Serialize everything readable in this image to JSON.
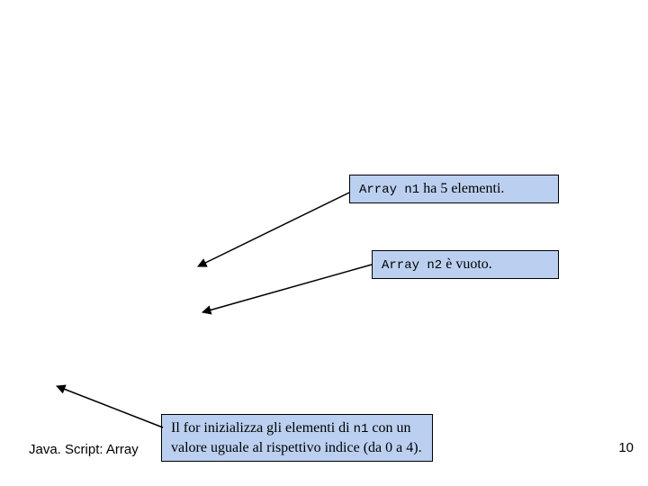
{
  "callouts": {
    "n1": {
      "code": "Array n1",
      "rest": " ha 5 elementi."
    },
    "n2": {
      "code": "Array n2",
      "rest": " è vuoto."
    },
    "for": {
      "pre": "Il for inizializza gli elementi di ",
      "code": "n1",
      "post": " con un valore uguale al rispettivo indice (da 0 a 4)."
    }
  },
  "footer": {
    "label": "Java. Script: Array",
    "page": "10"
  }
}
